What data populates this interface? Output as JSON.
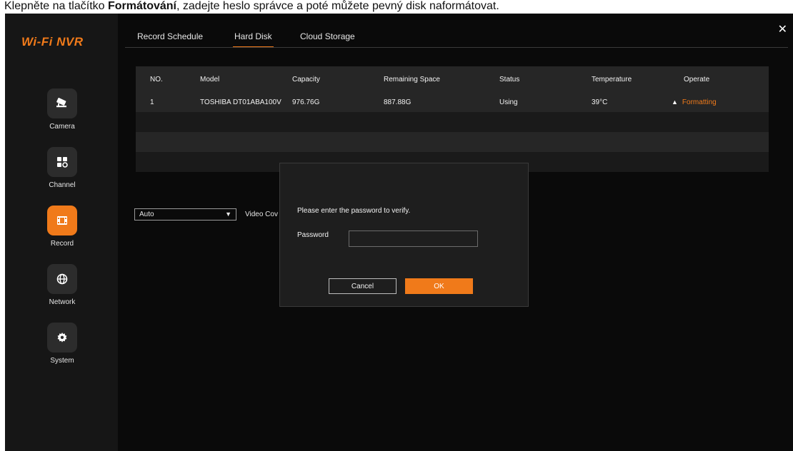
{
  "caption": {
    "prefix": "Klepněte na tlačítko ",
    "bold": "Formátování",
    "suffix": ", zadejte heslo správce a poté můžete pevný disk naformátovat."
  },
  "app": {
    "logo": "Wi-Fi NVR",
    "close": "✕"
  },
  "sidebar": {
    "items": [
      {
        "label": "Camera",
        "icon": "camera-icon",
        "active": false
      },
      {
        "label": "Channel",
        "icon": "channel-grid-icon",
        "active": false
      },
      {
        "label": "Record",
        "icon": "film-icon",
        "active": true
      },
      {
        "label": "Network",
        "icon": "globe-icon",
        "active": false
      },
      {
        "label": "System",
        "icon": "gear-icon",
        "active": false
      }
    ]
  },
  "tabs": [
    {
      "label": "Record Schedule",
      "active": false
    },
    {
      "label": "Hard Disk",
      "active": true
    },
    {
      "label": "Cloud Storage",
      "active": false
    }
  ],
  "table": {
    "headers": [
      "NO.",
      "Model",
      "Capacity",
      "Remaining Space",
      "Status",
      "Temperature",
      "Operate"
    ],
    "rows": [
      {
        "no": "1",
        "model": "TOSHIBA DT01ABA100V",
        "capacity": "976.76G",
        "remaining": "887.88G",
        "status": "Using",
        "temperature": "39°C",
        "operate": "Formatting"
      }
    ]
  },
  "controls": {
    "select_value": "Auto",
    "coverage_label": "Video Cov"
  },
  "dialog": {
    "message": "Please enter the password to verify.",
    "password_label": "Password",
    "password_value": "",
    "cancel_label": "Cancel",
    "ok_label": "OK"
  },
  "colors": {
    "accent": "#f07a1a",
    "background": "#0a0a0a",
    "sidebar": "#161616"
  }
}
